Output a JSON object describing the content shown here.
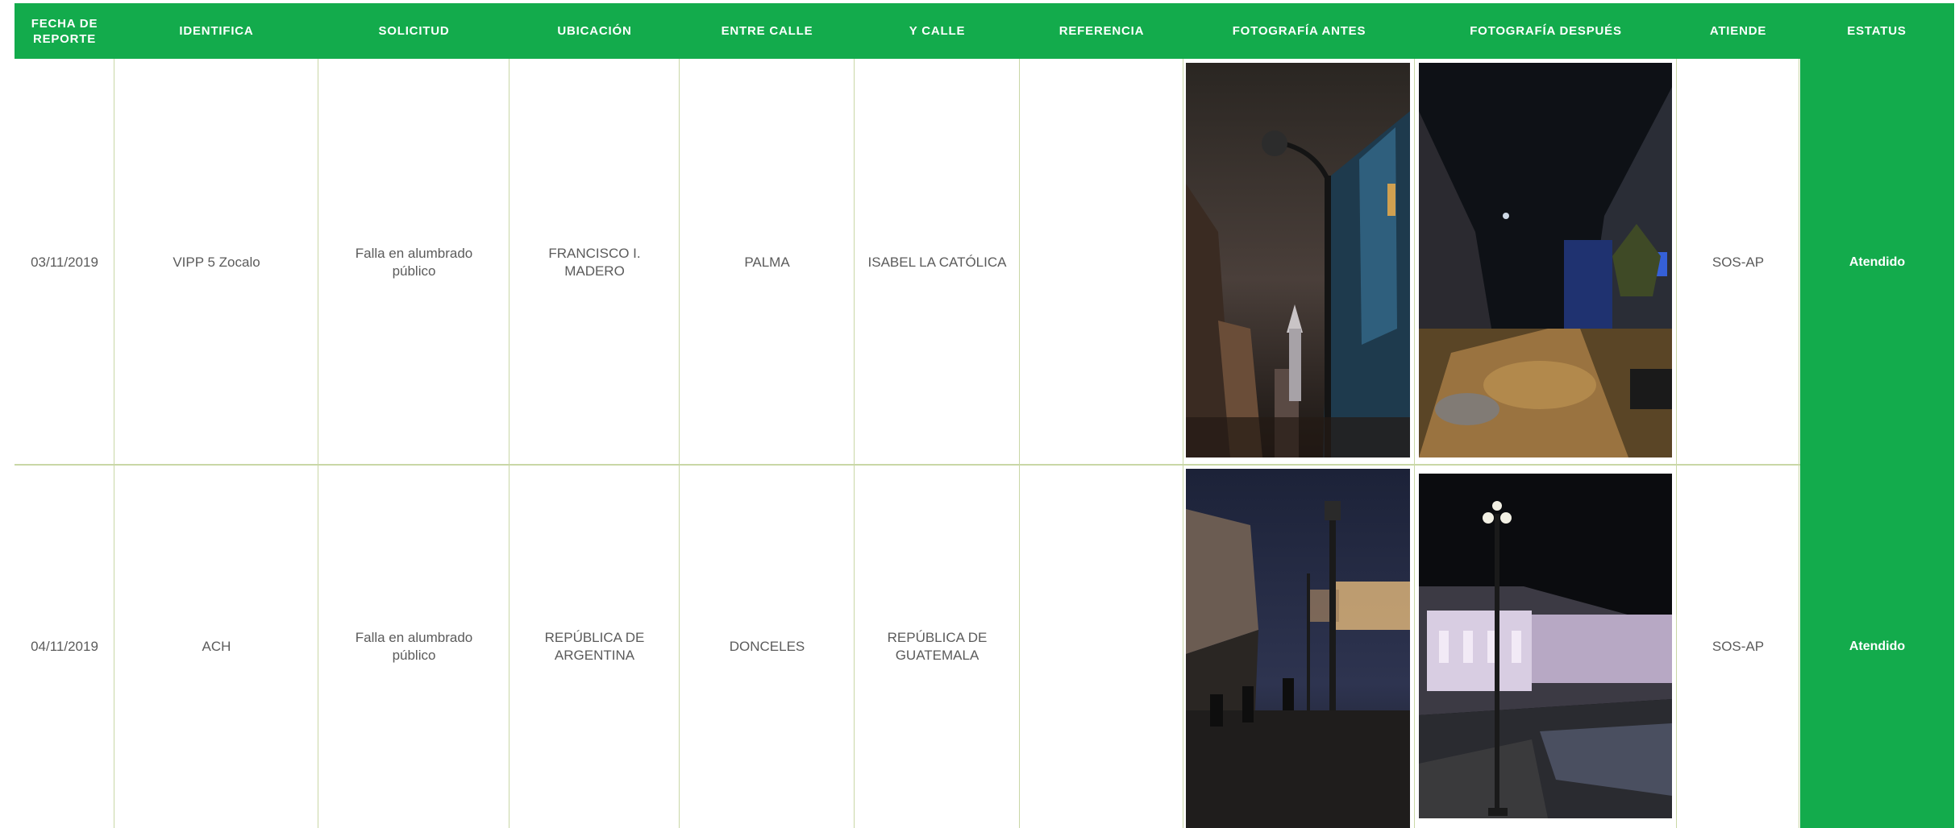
{
  "table": {
    "headers": {
      "fecha": "FECHA DE REPORTE",
      "identifica": "IDENTIFICA",
      "solicitud": "SOLICITUD",
      "ubicacion": "UBICACIÓN",
      "entre_calle": "ENTRE CALLE",
      "y_calle": "Y CALLE",
      "referencia": "REFERENCIA",
      "foto_antes": "FOTOGRAFÍA ANTES",
      "foto_despues": "FOTOGRAFÍA DESPUÉS",
      "atiende": "ATIENDE",
      "estatus": "ESTATUS"
    },
    "rows": [
      {
        "fecha": "03/11/2019",
        "identifica": "VIPP 5 Zocalo",
        "solicitud": "Falla en alumbrado público",
        "ubicacion": "FRANCISCO I. MADERO",
        "entre_calle": "PALMA",
        "y_calle": "ISABEL LA CATÓLICA",
        "referencia": "",
        "atiende": "SOS-AP",
        "estatus": "Atendido"
      },
      {
        "fecha": "04/11/2019",
        "identifica": "ACH",
        "solicitud": "Falla en alumbrado público",
        "ubicacion": "REPÚBLICA DE ARGENTINA",
        "entre_calle": "DONCELES",
        "y_calle": "REPÚBLICA DE GUATEMALA",
        "referencia": "",
        "atiende": "SOS-AP",
        "estatus": "Atendido"
      }
    ]
  },
  "colors": {
    "header_green": "#13ab4c",
    "status_green": "#13ab4c",
    "grid_line": "#c9d7a6",
    "body_text": "#5b5b5b"
  }
}
